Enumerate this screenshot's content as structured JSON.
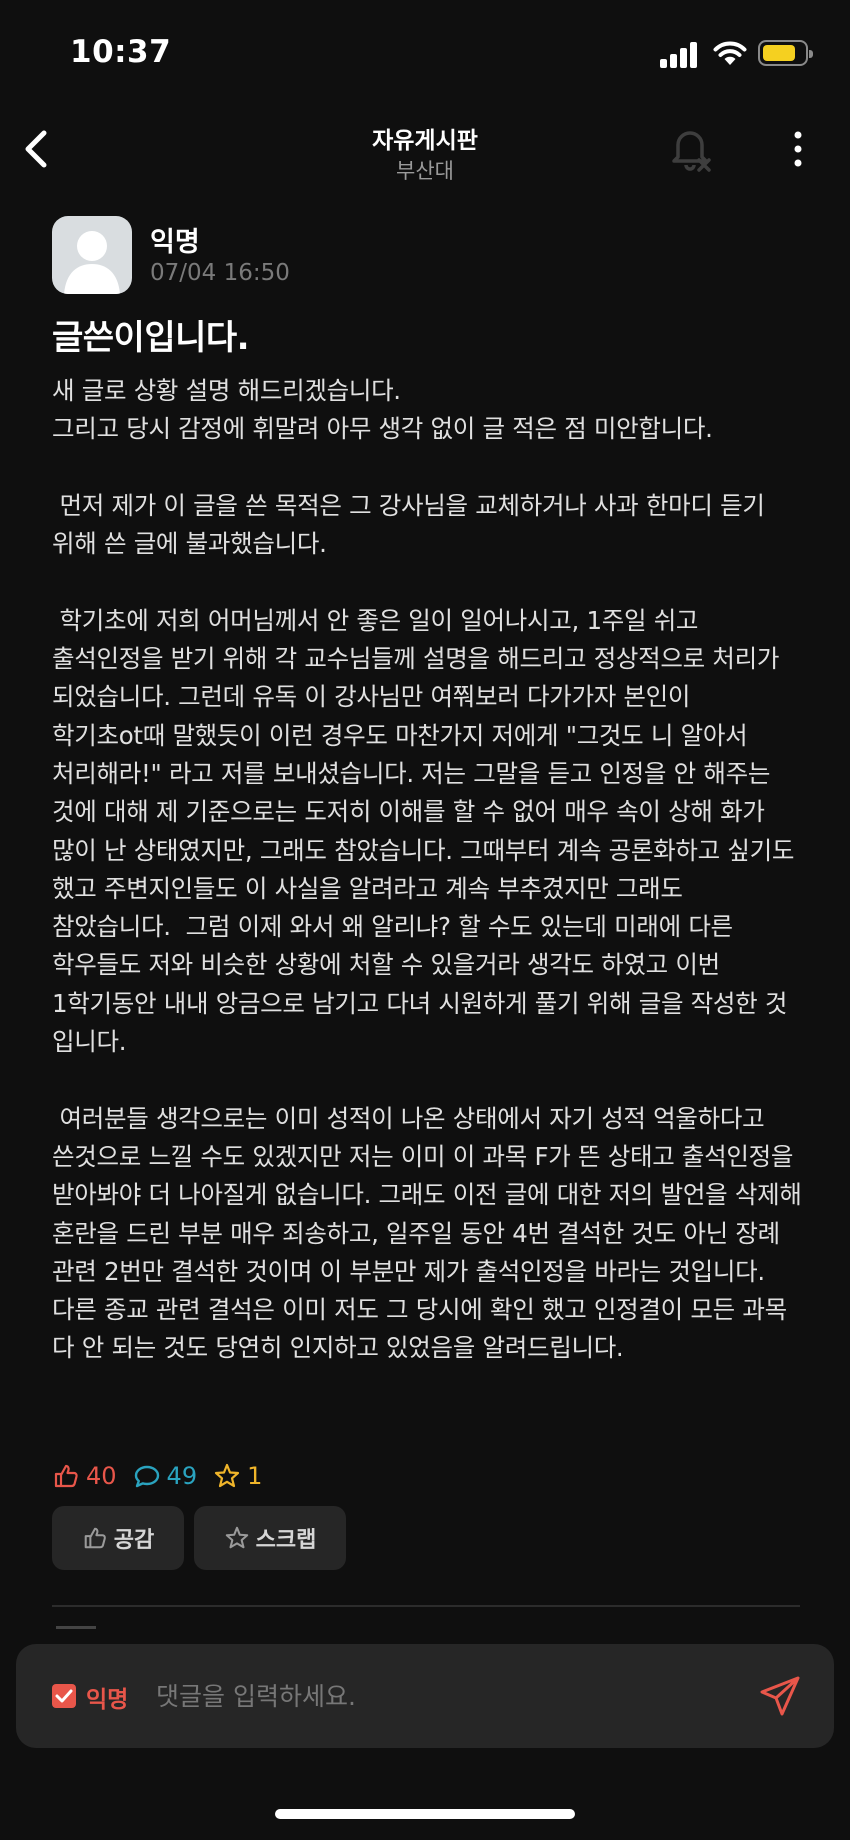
{
  "status_bar": {
    "time": "10:37"
  },
  "header": {
    "title": "자유게시판",
    "subtitle": "부산대"
  },
  "post": {
    "author": "익명",
    "time": "07/04 16:50",
    "title": "글쓴이입니다.",
    "body": "새 글로 상황 설명 해드리겠습니다.\n그리고 당시 감정에 휘말려 아무 생각 없이 글 적은 점 미안합니다.\n\n 먼저 제가 이 글을 쓴 목적은 그 강사님을 교체하거나 사과 한마디 듣기 위해 쓴 글에 불과했습니다.\n\n 학기초에 저희 어머님께서 안 좋은 일이 일어나시고, 1주일 쉬고 출석인정을 받기 위해 각 교수님들께 설명을 해드리고 정상적으로 처리가 되었습니다. 그런데 유독 이 강사님만 여쭤보러 다가가자 본인이 학기초ot때 말했듯이 이런 경우도 마찬가지 저에게 \"그것도 니 알아서 처리해라!\" 라고 저를 보내셨습니다. 저는 그말을 듣고 인정을 안 해주는 것에 대해 제 기준으로는 도저히 이해를 할 수 없어 매우 속이 상해 화가 많이 난 상태였지만, 그래도 참았습니다. 그때부터 계속 공론화하고 싶기도 했고 주변지인들도 이 사실을 알려라고 계속 부추겼지만 그래도 참았습니다.  그럼 이제 와서 왜 알리냐? 할 수도 있는데 미래에 다른 학우들도 저와 비슷한 상황에 처할 수 있을거라 생각도 하였고 이번 1학기동안 내내 앙금으로 남기고 다녀 시원하게 풀기 위해 글을 작성한 것 입니다.\n\n 여러분들 생각으로는 이미 성적이 나온 상태에서 자기 성적 억울하다고 쓴것으로 느낄 수도 있겠지만 저는 이미 이 과목 F가 뜬 상태고 출석인정을 받아봐야 더 나아질게 없습니다. 그래도 이전 글에 대한 저의 발언을 삭제해 혼란을 드린 부분 매우 죄송하고, 일주일 동안 4번 결석한 것도 아닌 장례 관련 2번만 결석한 것이며 이 부분만 제가 출석인정을 바라는 것입니다. 다른 종교 관련 결석은 이미 저도 그 당시에 확인 했고 인정결이 모든 과목 다 안 되는 것도 당연히 인지하고 있었음을 알려드립니다.",
    "likes": "40",
    "comments": "49",
    "scraps": "1"
  },
  "actions": {
    "empathy_label": "공감",
    "scrap_label": "스크랩"
  },
  "comment_bar": {
    "anon_label": "익명",
    "placeholder": "댓글을 입력하세요."
  },
  "colors": {
    "like": "#e8564a",
    "comment": "#2aa3bf",
    "scrap": "#f0b52a",
    "battery": "#f5d020"
  },
  "battery_level": 0.8
}
